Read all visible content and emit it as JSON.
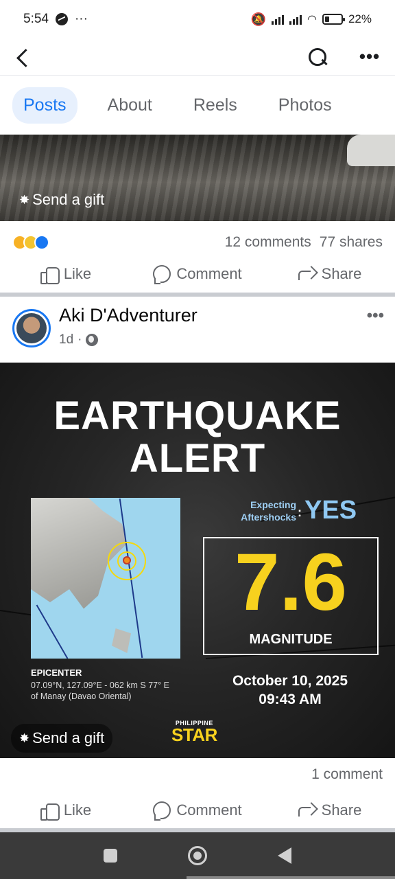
{
  "status_bar": {
    "time": "5:54",
    "dots": "···",
    "battery": "22%"
  },
  "tabs": [
    {
      "label": "Posts",
      "active": true
    },
    {
      "label": "About",
      "active": false
    },
    {
      "label": "Reels",
      "active": false
    },
    {
      "label": "Photos",
      "active": false
    }
  ],
  "prev_post": {
    "gift_label": "Send a gift",
    "comments": "12 comments",
    "shares": "77 shares",
    "actions": {
      "like": "Like",
      "comment": "Comment",
      "share": "Share"
    }
  },
  "post": {
    "author": "Aki D'Adventurer",
    "time": "1d",
    "separator": "·",
    "image": {
      "title_line1": "EARTHQUAKE",
      "title_line2": "ALERT",
      "aftershock_label_1": "Expecting",
      "aftershock_label_2": "Aftershocks",
      "aftershock_value": "YES",
      "magnitude": "7.6",
      "magnitude_label": "MAGNITUDE",
      "epicenter_title": "EPICENTER",
      "epicenter_line1": "07.09°N, 127.09°E - 062 km S 77° E",
      "epicenter_line2": "of Manay (Davao Oriental)",
      "date": "October 10, 2025",
      "time": "09:43 AM",
      "brand_top": "PHILIPPINE",
      "brand_main": "STAR",
      "gift_label": "Send a gift"
    },
    "comments": "1 comment",
    "actions": {
      "like": "Like",
      "comment": "Comment",
      "share": "Share"
    }
  },
  "colors": {
    "accent": "#1877f2",
    "magnitude": "#f7d11e",
    "tab_active_bg": "#e7f0fd"
  }
}
